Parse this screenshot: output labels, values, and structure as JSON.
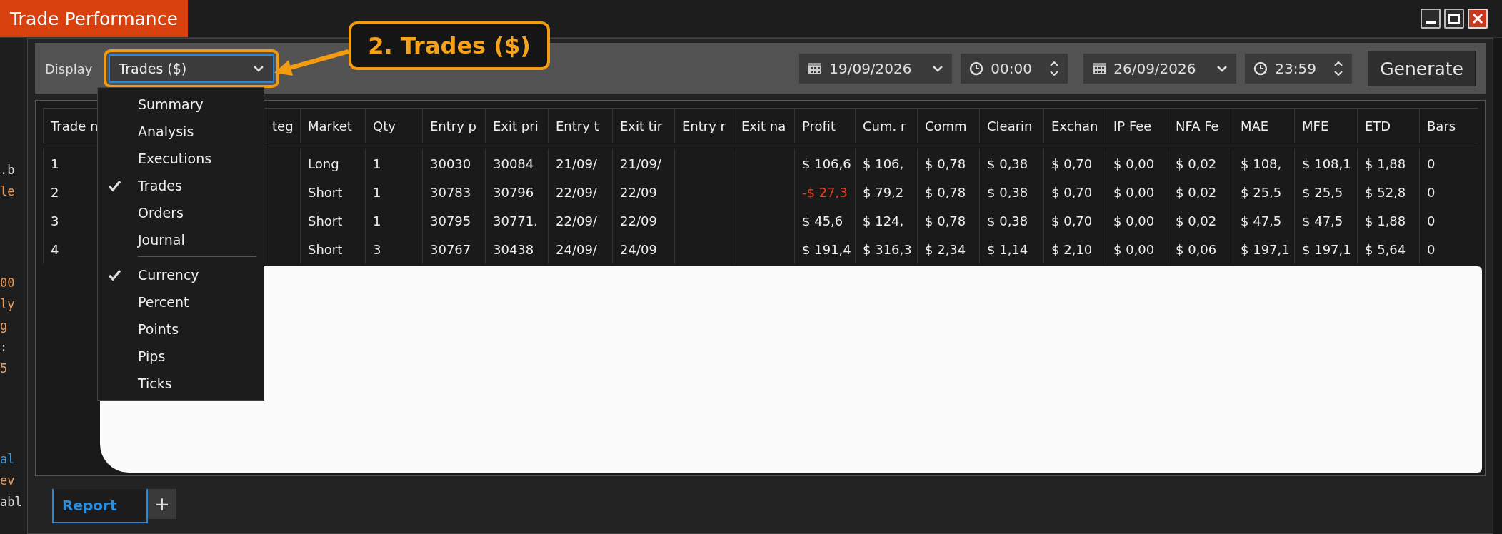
{
  "background_editor": {
    "lines": [
      ".b",
      "le",
      "00",
      "ly",
      "g",
      ":",
      "5",
      "al",
      "ev",
      "abl"
    ]
  },
  "window": {
    "title": "Trade Performance"
  },
  "toolbar": {
    "display_label": "Display",
    "display_select": {
      "value": "Trades ($)",
      "expanded": true
    },
    "start_date": "19/09/2026",
    "start_time": "00:00",
    "end_date": "26/09/2026",
    "end_time": "23:59",
    "generate_button": "Generate"
  },
  "display_menu": {
    "groups": [
      [
        {
          "label": "Summary",
          "checked": false
        },
        {
          "label": "Analysis",
          "checked": false
        },
        {
          "label": "Executions",
          "checked": false
        },
        {
          "label": "Trades",
          "checked": true
        },
        {
          "label": "Orders",
          "checked": false
        },
        {
          "label": "Journal",
          "checked": false
        }
      ],
      [
        {
          "label": "Currency",
          "checked": true
        },
        {
          "label": "Percent",
          "checked": false
        },
        {
          "label": "Points",
          "checked": false
        },
        {
          "label": "Pips",
          "checked": false
        },
        {
          "label": "Ticks",
          "checked": false
        }
      ]
    ]
  },
  "table": {
    "columns": [
      "Trade n",
      "teg",
      "Market",
      "Qty",
      "Entry p",
      "Exit pri",
      "Entry t",
      "Exit tir",
      "Entry r",
      "Exit na",
      "Profit",
      "Cum. r",
      "Comm",
      "Clearin",
      "Exchan",
      "IP Fee",
      "NFA Fe",
      "MAE",
      "MFE",
      "ETD",
      "Bars"
    ],
    "rows": [
      {
        "cells": [
          "1",
          null,
          "Long",
          "1",
          "30030",
          "30084",
          "21/09/",
          "21/09/",
          null,
          null,
          {
            "text": "$ 106,6",
            "negative": false
          },
          "$ 106,",
          "$ 0,78",
          "$ 0,38",
          "$ 0,70",
          "$ 0,00",
          "$ 0,02",
          "$ 108,",
          "$ 108,1",
          "$ 1,88",
          "0"
        ]
      },
      {
        "cells": [
          "2",
          null,
          "Short",
          "1",
          "30783",
          "30796",
          "22/09/",
          "22/09",
          null,
          null,
          {
            "text": "-$ 27,3",
            "negative": true
          },
          "$ 79,2",
          "$ 0,78",
          "$ 0,38",
          "$ 0,70",
          "$ 0,00",
          "$ 0,02",
          "$ 25,5",
          "$ 25,5",
          "$ 52,8",
          "0"
        ]
      },
      {
        "cells": [
          "3",
          null,
          "Short",
          "1",
          "30795",
          "30771.",
          "22/09/",
          "22/09",
          null,
          null,
          {
            "text": "$ 45,6",
            "negative": false
          },
          "$ 124,",
          "$ 0,78",
          "$ 0,38",
          "$ 0,70",
          "$ 0,00",
          "$ 0,02",
          "$ 47,5",
          "$ 47,5",
          "$ 1,88",
          "0"
        ]
      },
      {
        "cells": [
          "4",
          null,
          "Short",
          "3",
          "30767",
          "30438",
          "24/09/",
          "24/09",
          null,
          null,
          {
            "text": "$ 191,4",
            "negative": false
          },
          "$ 316,3",
          "$ 2,34",
          "$ 1,14",
          "$ 2,10",
          "$ 0,00",
          "$ 0,06",
          "$ 197,1",
          "$ 197,1",
          "$ 5,64",
          "0"
        ]
      }
    ]
  },
  "annotation": {
    "callout": "2. Trades ($)"
  },
  "bottom_tabs": {
    "tabs": [
      {
        "label": "Report",
        "selected": true
      }
    ],
    "add_button": "+"
  }
}
